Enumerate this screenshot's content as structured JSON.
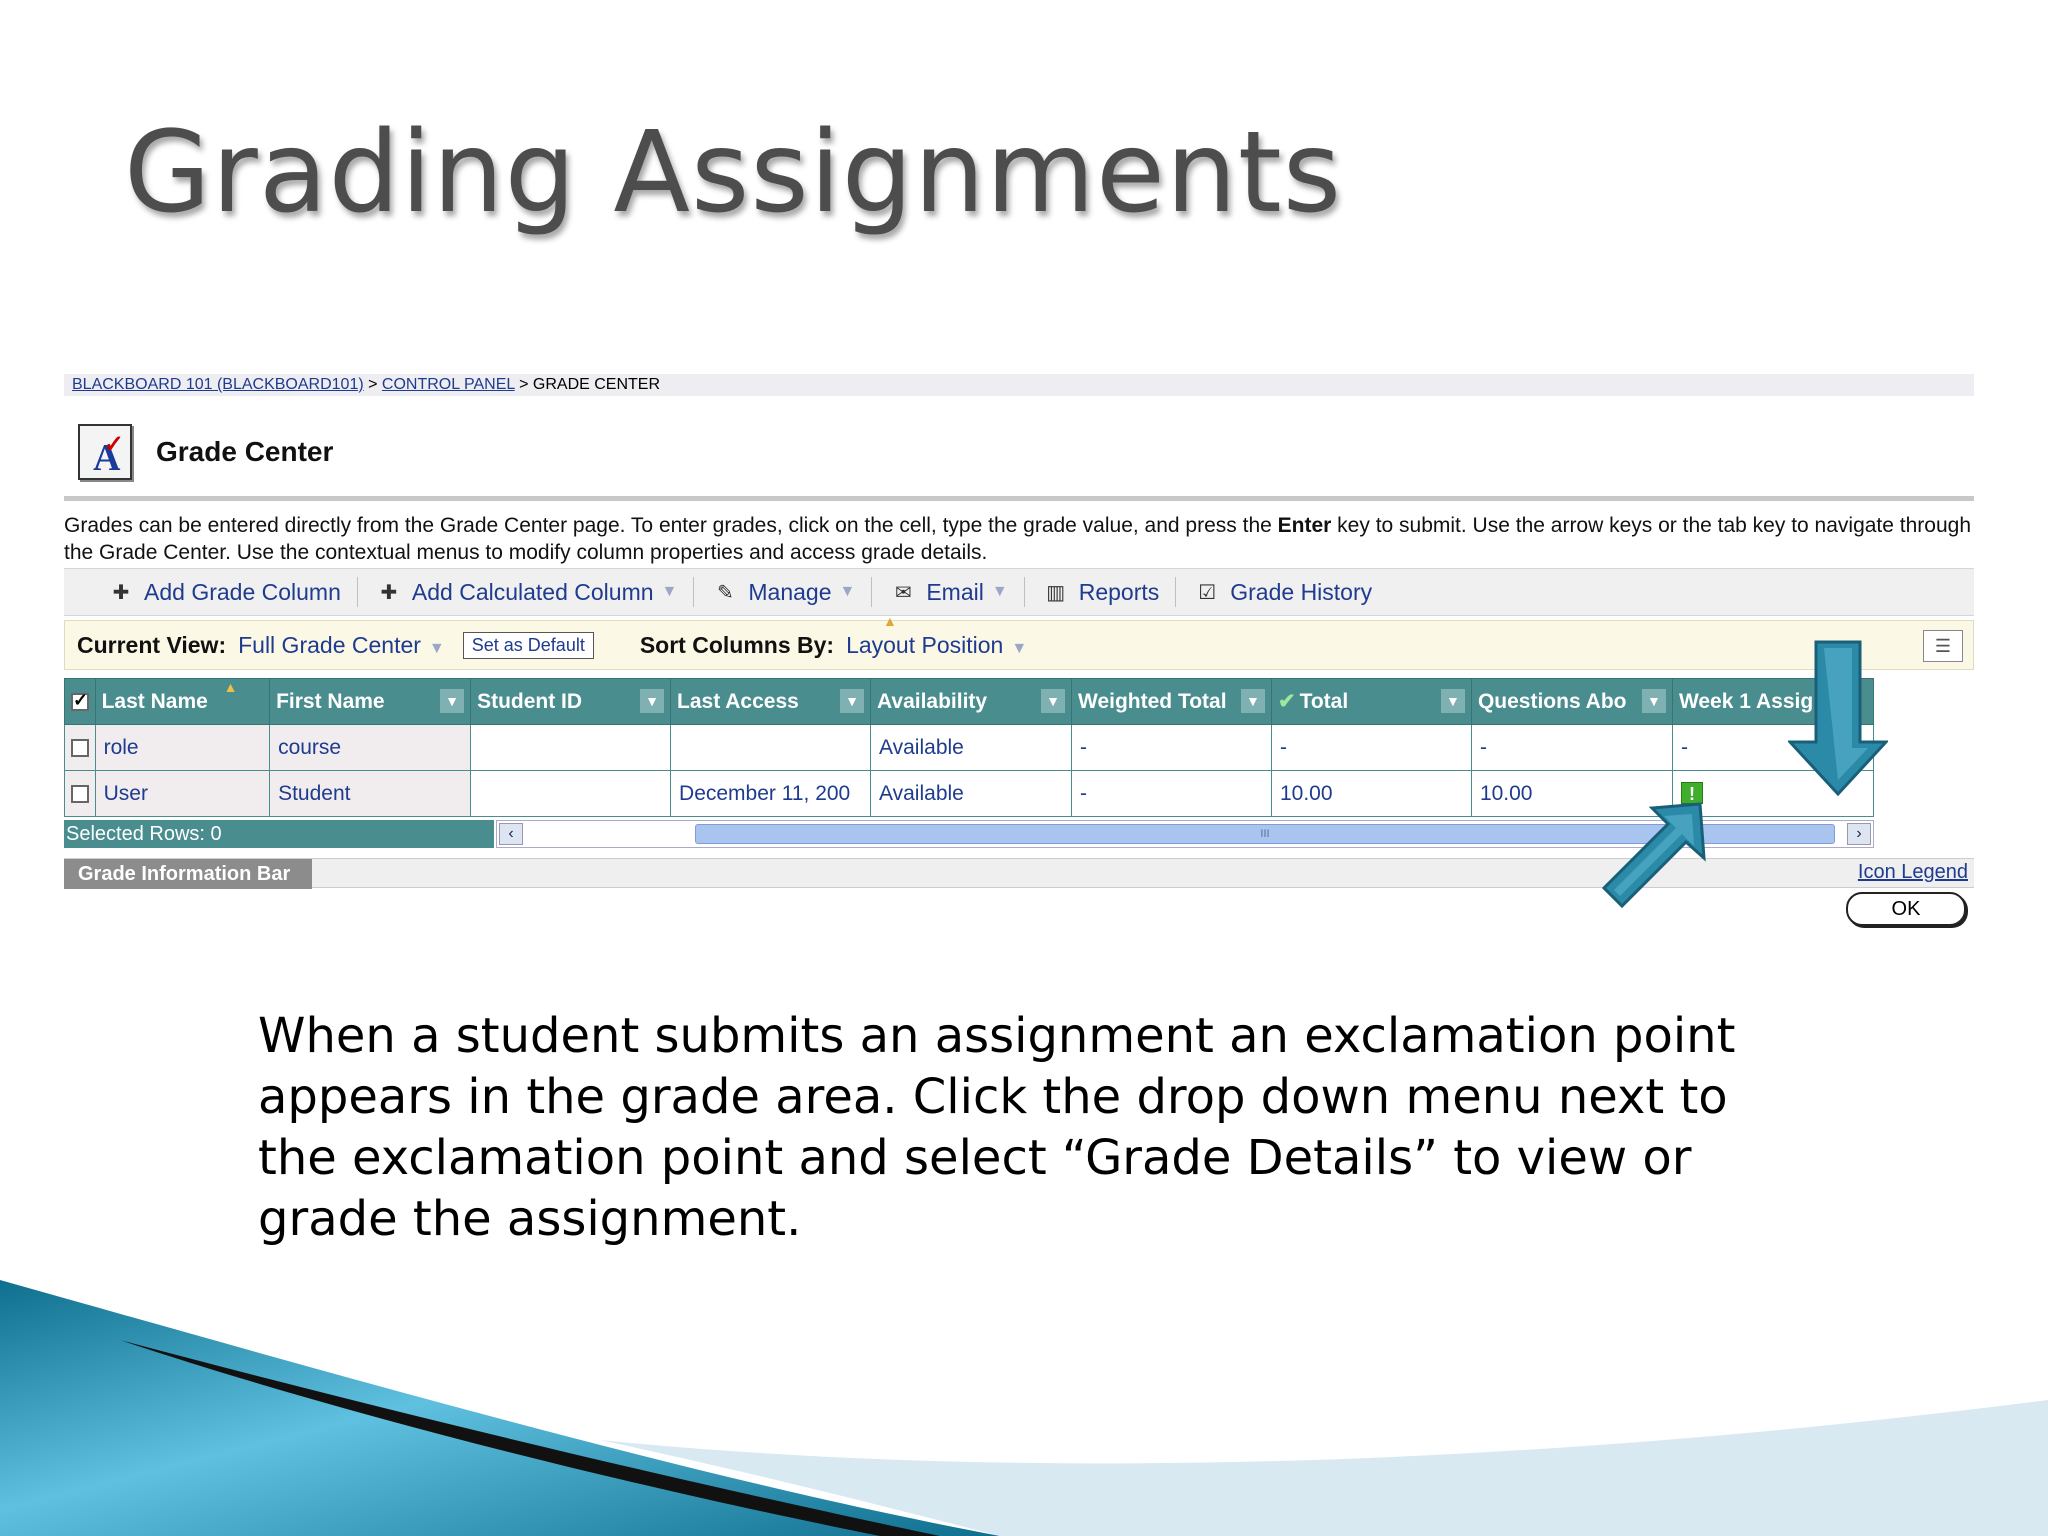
{
  "slide": {
    "title": "Grading Assignments",
    "body": "When a student submits an assignment an exclamation point appears in the grade area.  Click the drop down menu next to the exclamation point and select “Grade Details” to view or grade the assignment."
  },
  "breadcrumb": {
    "course": "BLACKBOARD 101 (BLACKBOARD101)",
    "sep1": " > ",
    "control_panel": "CONTROL PANEL",
    "sep2": " > ",
    "current": "GRADE CENTER"
  },
  "header": {
    "title": "Grade Center",
    "description_html_parts": {
      "part1": "Grades can be entered directly from the Grade Center page. To enter grades, click on the cell, type the grade value, and press the ",
      "bold": "Enter",
      "part2": " key to submit. Use the arrow keys or the tab key to navigate through the Grade Center. Use the contextual menus to modify column properties and access grade details."
    }
  },
  "toolbar": {
    "add_grade_column": "Add Grade Column",
    "add_calculated_column": "Add Calculated Column",
    "manage": "Manage",
    "email": "Email",
    "reports": "Reports",
    "grade_history": "Grade History"
  },
  "viewbar": {
    "current_view_label": "Current View:",
    "current_view_value": "Full Grade Center",
    "set_default": "Set as Default",
    "sort_label": "Sort Columns By:",
    "sort_value": "Layout Position"
  },
  "grid": {
    "columns": [
      "Last Name",
      "First Name",
      "Student ID",
      "Last Access",
      "Availability",
      "Weighted Total",
      "Total",
      "Questions Abo",
      "Week 1 Assig"
    ],
    "rows": [
      [
        "role",
        "course",
        "",
        "",
        "Available",
        "-",
        "-",
        "-",
        "-"
      ],
      [
        "User",
        "Student",
        "",
        "December 11, 200",
        "Available",
        "-",
        "10.00",
        "10.00",
        "!"
      ]
    ],
    "selected_rows": "Selected Rows: 0",
    "scroll_grip": "III"
  },
  "footer": {
    "info_bar": "Grade Information Bar",
    "icon_legend": "Icon Legend",
    "ok": "OK"
  },
  "colors": {
    "header_teal": "#4a8d8f",
    "link_blue": "#1f3b8f",
    "arrow_teal": "#2a8aa8",
    "needs_grading_green": "#3fae2a"
  }
}
